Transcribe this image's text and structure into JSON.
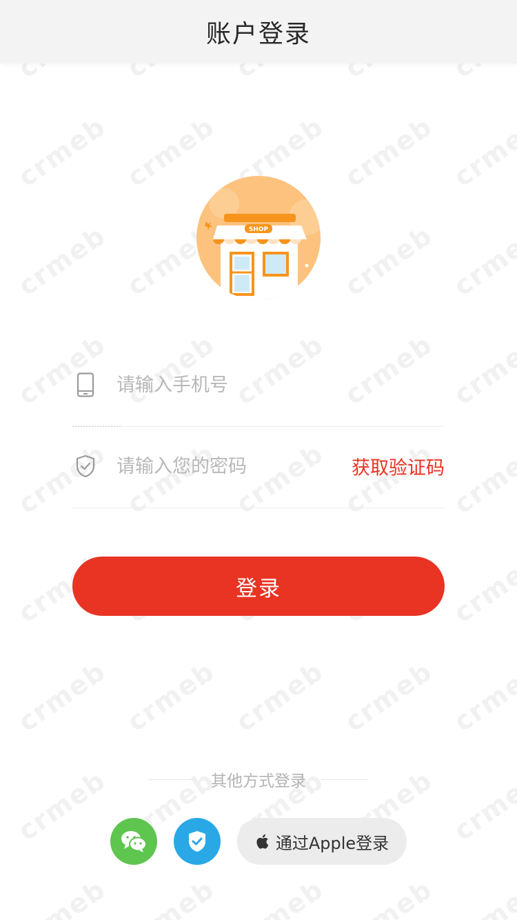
{
  "header": {
    "title": "账户登录"
  },
  "form": {
    "phone_placeholder": "请输入手机号",
    "password_placeholder": "请输入您的密码",
    "get_code_label": "获取验证码",
    "login_label": "登录"
  },
  "other_login": {
    "label": "其他方式登录",
    "apple_label": "通过Apple登录"
  },
  "logo": {
    "badge_text": "SHOP"
  },
  "watermark": {
    "text": "crmeb"
  },
  "colors": {
    "accent": "#e93323",
    "wechat": "#5ec54f",
    "shield": "#2aa8e6",
    "logo_bg": "#fcc27e",
    "logo_orange": "#f7941d"
  },
  "icons": {
    "phone": "phone-icon",
    "password": "shield-check-icon",
    "wechat": "wechat-icon",
    "verify": "shield-check-icon",
    "apple": "apple-icon"
  }
}
